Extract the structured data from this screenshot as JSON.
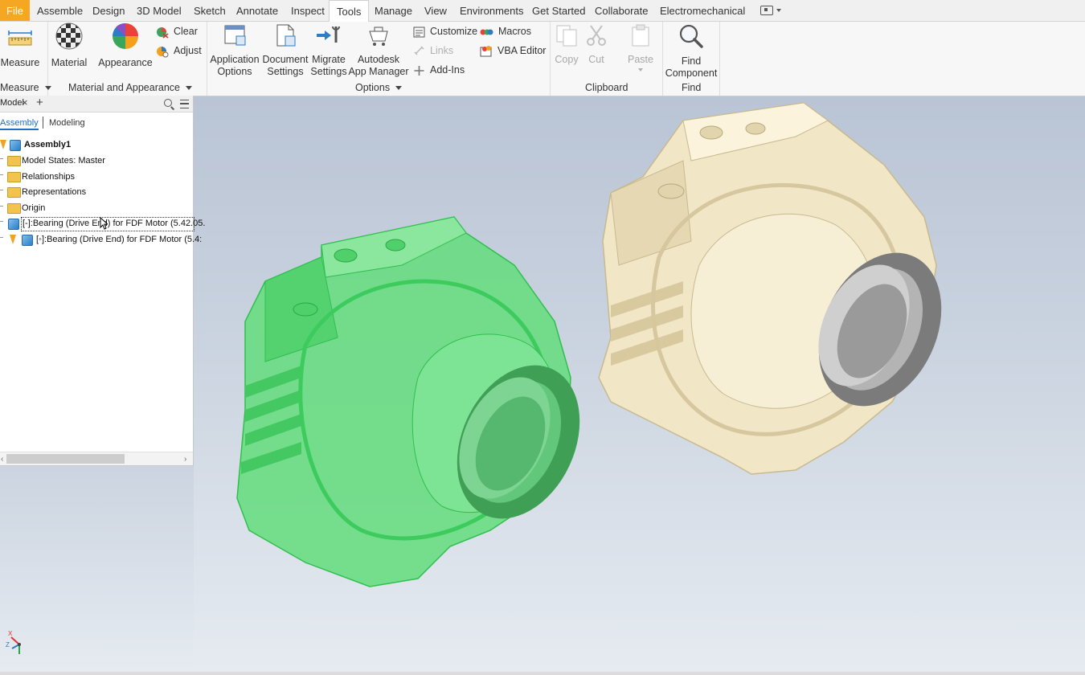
{
  "tabs": {
    "file": "File",
    "assemble": "Assemble",
    "design": "Design",
    "model3d": "3D Model",
    "sketch": "Sketch",
    "annotate": "Annotate",
    "inspect": "Inspect",
    "tools": "Tools",
    "manage": "Manage",
    "view": "View",
    "environments": "Environments",
    "get_started": "Get Started",
    "collaborate": "Collaborate",
    "electromechanical": "Electromechanical"
  },
  "ribbon": {
    "measure": "Measure",
    "material": "Material",
    "appearance": "Appearance",
    "clear": "Clear",
    "adjust": "Adjust",
    "app_options_1": "Application",
    "app_options_2": "Options",
    "doc_settings_1": "Document",
    "doc_settings_2": "Settings",
    "migrate_1": "Migrate",
    "migrate_2": "Settings",
    "appmgr_1": "Autodesk",
    "appmgr_2": "App Manager",
    "customize": "Customize",
    "links": "Links",
    "addins": "Add-Ins",
    "macros": "Macros",
    "vba": "VBA Editor",
    "copy": "Copy",
    "cut": "Cut",
    "paste": "Paste",
    "find_1": "Find",
    "find_2": "Component",
    "groups": {
      "measure": "Measure",
      "material_appearance": "Material and Appearance",
      "options": "Options",
      "clipboard": "Clipboard",
      "find": "Find"
    }
  },
  "browser": {
    "tab_label": "Model",
    "sub_assembly": "Assembly",
    "sub_modeling": "Modeling",
    "tree": {
      "root": "Assembly1",
      "model_states": "Model States: Master",
      "relationships": "Relationships",
      "representations": "Representations",
      "origin": "Origin",
      "bearing1": "[-]:Bearing (Drive End) for FDF Motor (5.42.05.",
      "bearing2": "[◦]:Bearing (Drive End) for FDF Motor (5.4:"
    }
  },
  "triad": {
    "x": "X",
    "z": "Z"
  },
  "colors": {
    "file_tab": "#f5a623",
    "selected_part": "#5fdc78",
    "part_cream": "#f1e6c6",
    "bearing_grey": "#8c8c8c",
    "viewport_top": "#b9c4d5",
    "viewport_bottom": "#e6ebf1"
  }
}
